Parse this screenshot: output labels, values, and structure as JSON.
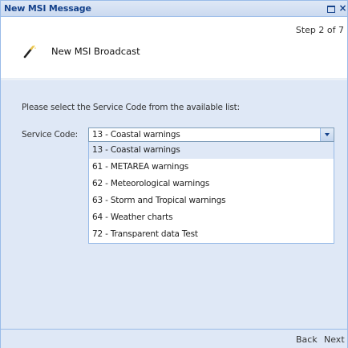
{
  "window": {
    "title": "New MSI Message"
  },
  "header": {
    "step": "Step 2 of 7",
    "title": "New MSI Broadcast"
  },
  "body": {
    "instruction": "Please select the Service Code from the available list:",
    "service_code_label": "Service Code:",
    "selected_value": "13 - Coastal warnings",
    "options": [
      "13 - Coastal warnings",
      "61 - METAREA warnings",
      "62 - Meteorological warnings",
      "63 - Storm and Tropical warnings",
      "64 - Weather charts",
      "72 - Transparent data Test"
    ]
  },
  "footer": {
    "back_label": "Back",
    "next_label": "Next"
  },
  "icons": {
    "wizard": "magic-wand-icon",
    "maximize": "maximize-icon",
    "close": "close-icon",
    "dropdown": "chevron-down-icon"
  },
  "colors": {
    "title_text": "#15428b",
    "panel_background": "#dfe8f6",
    "border": "#99bbe8"
  }
}
